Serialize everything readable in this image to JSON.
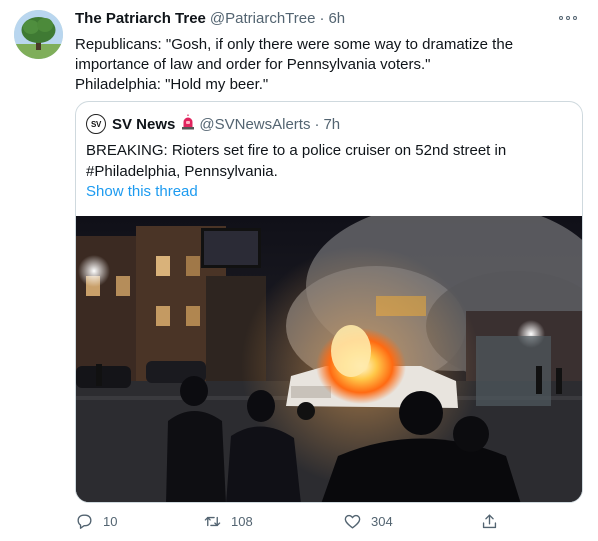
{
  "tweet": {
    "author": {
      "display_name": "The Patriarch Tree",
      "handle": "@PatriarchTree",
      "separator": "·",
      "time": "6h",
      "avatar_icon": "tree-avatar"
    },
    "text_lines": [
      "Republicans: \"Gosh, if only there were some way to dramatize the",
      "importance of law and order for Pennsylvania voters.\"",
      "Philadelphia: \"Hold my beer.\""
    ],
    "more_icon": "more-dots-icon"
  },
  "quoted": {
    "avatar_text": "SV",
    "display_name": "SV News",
    "siren_icon": "siren-emoji-icon",
    "handle": "@SVNewsAlerts",
    "separator": "·",
    "time": "7h",
    "text_lines": [
      "BREAKING: Rioters set fire to a police cruiser on 52nd street in",
      "#Philadelphia, Pennsylvania."
    ],
    "show_thread": "Show this thread",
    "media_icon": "burning-police-car-photo"
  },
  "actions": {
    "reply": {
      "icon": "reply-icon",
      "count": "10"
    },
    "retweet": {
      "icon": "retweet-icon",
      "count": "108"
    },
    "like": {
      "icon": "heart-icon",
      "count": "304"
    },
    "share": {
      "icon": "share-icon"
    }
  },
  "colors": {
    "text": "#0f1419",
    "secondary": "#536471",
    "link": "#1d9bf0",
    "border": "#cfd9de"
  }
}
